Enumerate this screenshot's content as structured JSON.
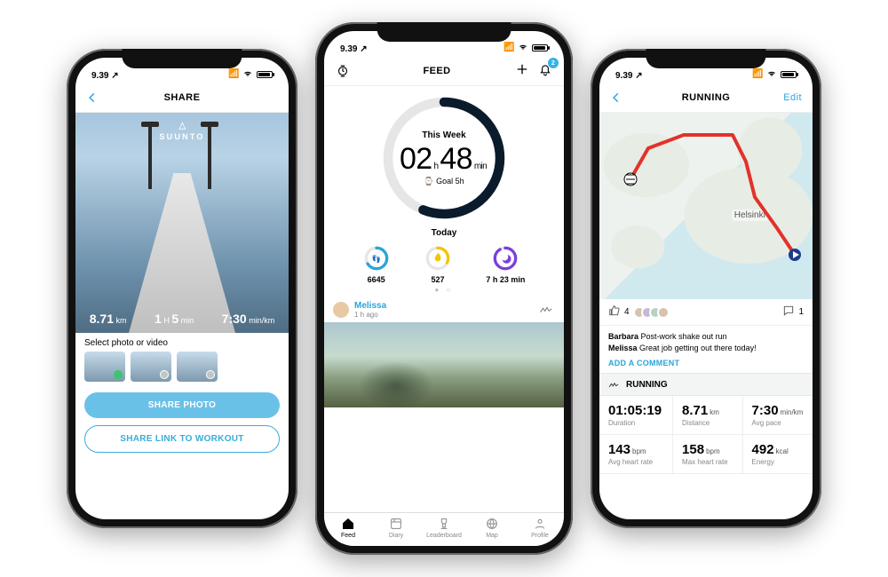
{
  "status": {
    "time": "9.39 ↗"
  },
  "share": {
    "title": "SHARE",
    "brand": "SUUNTO",
    "stats": {
      "distance_val": "8.71",
      "distance_unit": "km",
      "duration_h": "1",
      "duration_h_unit": "H",
      "duration_m": "5",
      "duration_m_unit": "min",
      "pace_val": "7:30",
      "pace_unit": "min/km"
    },
    "select_label": "Select photo or video",
    "btn_primary": "SHARE PHOTO",
    "btn_secondary": "SHARE LINK TO WORKOUT"
  },
  "feed": {
    "title": "FEED",
    "badge": "2",
    "ring": {
      "label": "This Week",
      "hours": "02",
      "h_unit": "h",
      "mins": "48",
      "m_unit": "min",
      "goal": "Goal 5h"
    },
    "today_label": "Today",
    "today": {
      "steps": "6645",
      "calories": "527",
      "sleep": "7 h 23 min"
    },
    "post": {
      "name": "Melissa",
      "sub": "1 h ago"
    },
    "tabs": {
      "feed": "Feed",
      "diary": "Diary",
      "leaderboard": "Leaderboard",
      "map": "Map",
      "profile": "Profile"
    }
  },
  "run": {
    "title": "RUNNING",
    "edit": "Edit",
    "city": "Helsinki",
    "likes": "4",
    "comments_count": "1",
    "c1_name": "Barbara",
    "c1_text": "Post-work shake out run",
    "c2_name": "Melissa",
    "c2_text": "Great job getting out there today!",
    "add_comment": "ADD A COMMENT",
    "section": "RUNNING",
    "m": [
      {
        "v": "01:05:19",
        "u": "",
        "l": "Duration"
      },
      {
        "v": "8.71",
        "u": "km",
        "l": "Distance"
      },
      {
        "v": "7:30",
        "u": "min/km",
        "l": "Avg pace"
      },
      {
        "v": "143",
        "u": "bpm",
        "l": "Avg heart rate"
      },
      {
        "v": "158",
        "u": "bpm",
        "l": "Max heart rate"
      },
      {
        "v": "492",
        "u": "kcal",
        "l": "Energy"
      }
    ]
  }
}
